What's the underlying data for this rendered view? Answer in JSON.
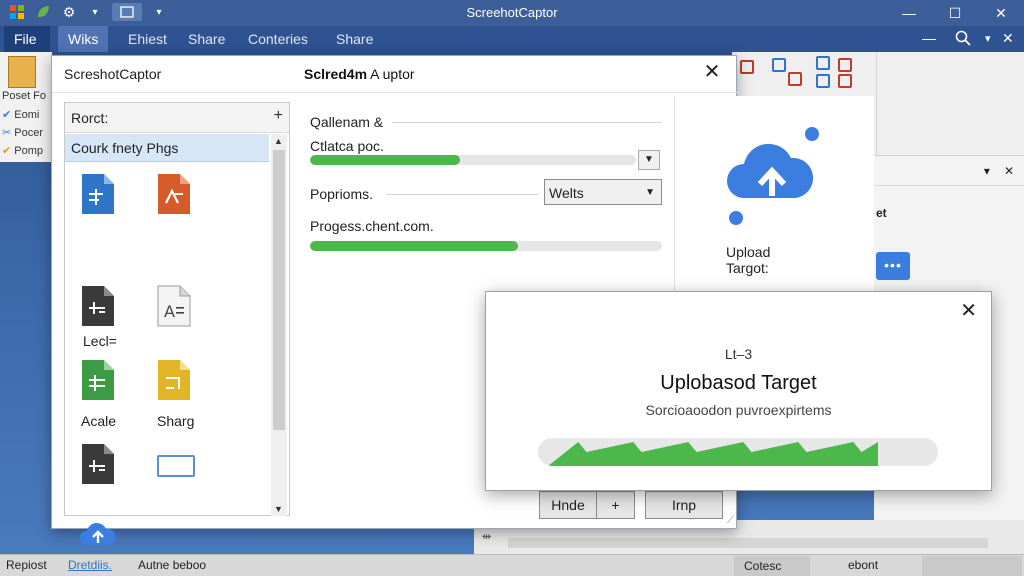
{
  "app": {
    "title": "ScreehotCaptor"
  },
  "colors": {
    "accent": "#2f5291",
    "progress": "#4cb84c",
    "selection": "#d6e6f7",
    "upload_icon": "#3c7de0"
  },
  "tabs": [
    {
      "label": "File"
    },
    {
      "label": "Wiks"
    },
    {
      "label": "Ehiest"
    },
    {
      "label": "Share"
    },
    {
      "label": "Conteries"
    },
    {
      "label": "Share"
    }
  ],
  "background": {
    "left_items": [
      {
        "label": "Poset Fo"
      },
      {
        "label": "Eomi"
      },
      {
        "label": "Pocer"
      },
      {
        "label": "Pomp"
      }
    ],
    "panel_right_label": "et",
    "status": {
      "left": "Repiost",
      "link": "Dretdiis.",
      "mid": "Autne beboo",
      "box1": "Cotesc",
      "right": "ebont"
    }
  },
  "dialog": {
    "title_left": "ScreshotCaptor",
    "title_center_bold": "Sclred4m",
    "title_center_rest": " A uptor",
    "list": {
      "header": "Rorct:",
      "selected": "Courk fnety Phgs",
      "items": [
        {
          "label": "",
          "icon": "doc-blue-icon",
          "color": "#2e74c9"
        },
        {
          "label": "",
          "icon": "doc-orange-icon",
          "color": "#d55b2b"
        },
        {
          "label": "Lecl=",
          "icon": "doc-dark-icon",
          "color": "#3a3a3a"
        },
        {
          "label": "",
          "icon": "doc-text-icon",
          "color": "#eeeeee"
        },
        {
          "label": "Acale",
          "icon": "doc-green-icon",
          "color": "#3e9b45"
        },
        {
          "label": "Sharg",
          "icon": "doc-yellow-icon",
          "color": "#e2b526"
        },
        {
          "label": "",
          "icon": "doc-dark-icon",
          "color": "#3a3a3a"
        },
        {
          "label": "",
          "icon": "rectangle-icon",
          "color": "#5b8fd6"
        },
        {
          "label": "",
          "icon": "cloud-upload-icon",
          "color": "#3c7de0"
        }
      ]
    },
    "form": {
      "field1_label": "Qallenam &",
      "field2_label": "Ctlatca poc.",
      "field2_progress": 0.46,
      "field3_label": "Poprioms.",
      "field3_value": "Welts",
      "field4_label": "Progess.chent.com.",
      "field4_progress": 0.59
    },
    "upload_label": "Upload Targot:",
    "buttons": {
      "hide": "Hnde",
      "plus": "+",
      "imp": "Irnp"
    }
  },
  "popup": {
    "small": "Lt–3",
    "title": "Uplobasod Target",
    "desc": "Sorcioaoodon puvroexpirtems",
    "progress": 0.85
  }
}
